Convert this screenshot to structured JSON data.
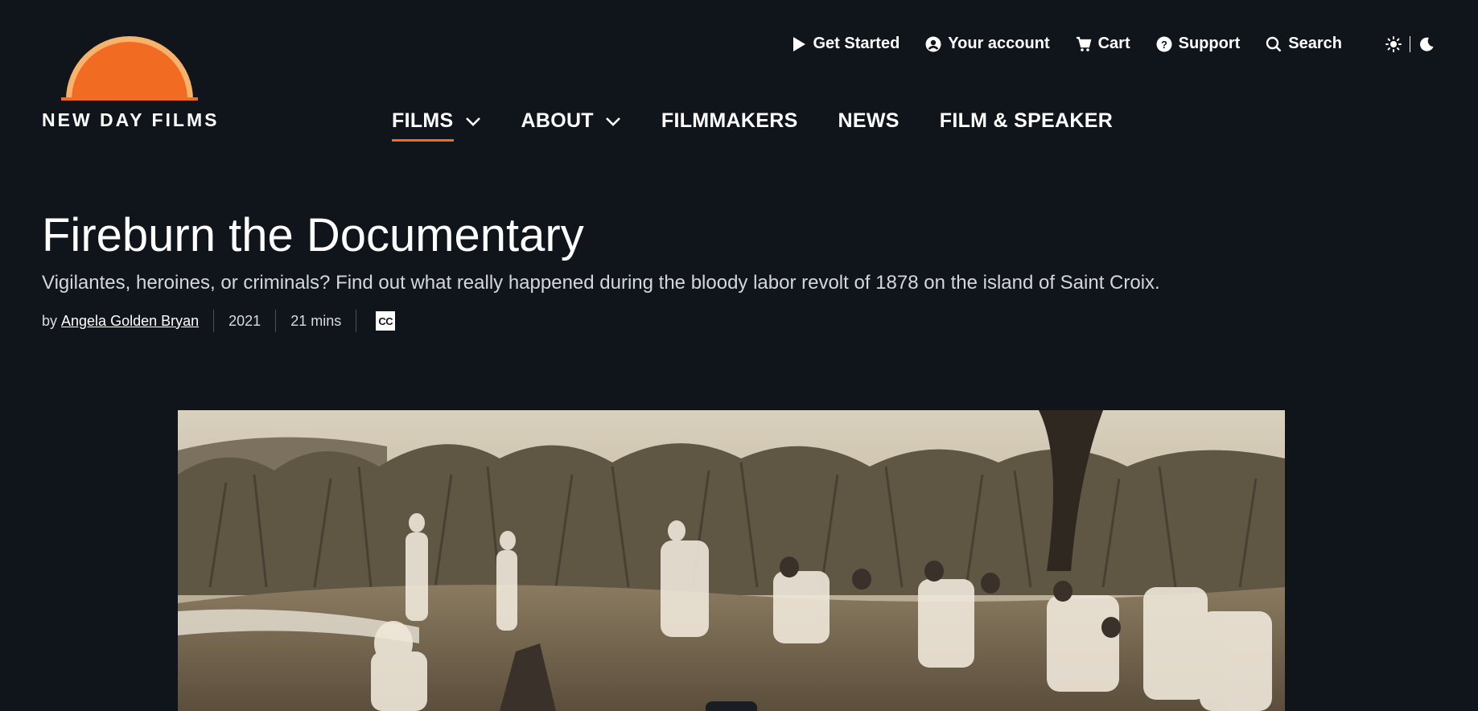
{
  "brand": {
    "name": "NEW DAY FILMS",
    "sun_color": "#f26b22",
    "sun_rim": "#f7b26b"
  },
  "utility_nav": [
    {
      "label": "Get Started",
      "icon": "play-icon"
    },
    {
      "label": "Your account",
      "icon": "user-circle-icon"
    },
    {
      "label": "Cart",
      "icon": "cart-icon"
    },
    {
      "label": "Support",
      "icon": "help-circle-icon"
    },
    {
      "label": "Search",
      "icon": "search-icon"
    }
  ],
  "theme_toggle": {
    "light_icon": "sun-icon",
    "dark_icon": "moon-icon"
  },
  "main_nav": [
    {
      "label": "FILMS",
      "dropdown": true,
      "active": true
    },
    {
      "label": "ABOUT",
      "dropdown": true
    },
    {
      "label": "FILMMAKERS"
    },
    {
      "label": "NEWS"
    },
    {
      "label": "FILM & SPEAKER"
    }
  ],
  "film": {
    "title": "Fireburn the Documentary",
    "tagline": "Vigilantes, heroines, or criminals? Find out what really happened during the bloody labor revolt of 1878 on the island of Saint Croix.",
    "by_prefix": "by",
    "director": "Angela Golden Bryan",
    "year": "2021",
    "duration": "21 mins",
    "cc_label": "CC"
  },
  "colors": {
    "background": "#10141b",
    "accent": "#f26b22"
  }
}
